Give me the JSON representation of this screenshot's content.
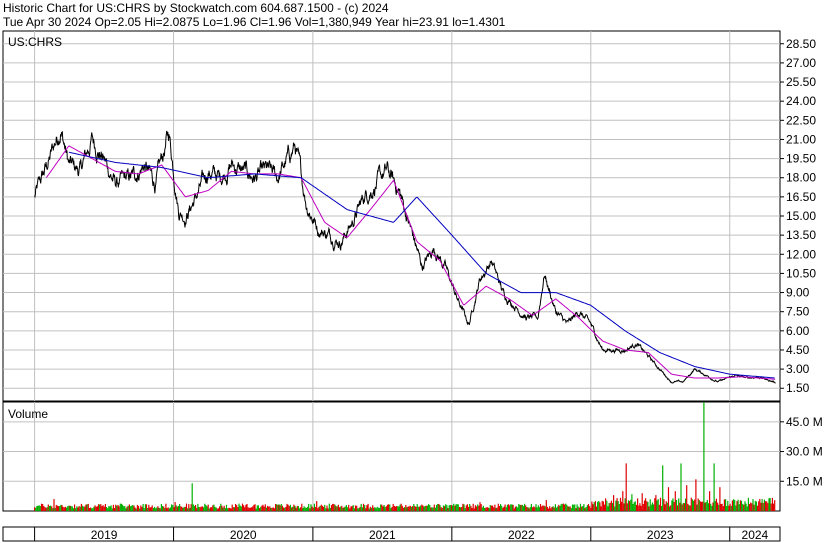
{
  "header": {
    "line1": "Historic Chart for US:CHRS by Stockwatch.com 604.687.1500 - (c) 2024",
    "line2": "Tue Apr 30 2024   Op=2.05  Hi=2.0875   Lo=1.96   Cl=1.96   Vol=1,380,949   Year hi=23.91   lo=1.4301"
  },
  "colors": {
    "price": "#000000",
    "ma_short": "#c000c0",
    "ma_long": "#0000c0",
    "volume_up": "#00b000",
    "volume_down": "#e00000",
    "grid": "#c0c0c0"
  },
  "chart_data": [
    {
      "type": "line",
      "label": "US:CHRS",
      "x_years": [
        "2019",
        "2020",
        "2021",
        "2022",
        "2023",
        "2024"
      ],
      "y_ticks": [
        "28.50",
        "27.00",
        "25.50",
        "24.00",
        "22.50",
        "21.00",
        "19.50",
        "18.00",
        "16.50",
        "15.00",
        "13.50",
        "12.00",
        "10.50",
        "9.00",
        "7.50",
        "6.00",
        "4.50",
        "3.00",
        "1.50"
      ],
      "ylim": [
        0.5,
        29.5
      ],
      "price_keypoints": [
        [
          "2019-01-01",
          16.5
        ],
        [
          "2019-02-10",
          19.5
        ],
        [
          "2019-03-10",
          22.0
        ],
        [
          "2019-04-01",
          19.0
        ],
        [
          "2019-05-01",
          18.5
        ],
        [
          "2019-06-01",
          21.0
        ],
        [
          "2019-07-01",
          19.5
        ],
        [
          "2019-08-01",
          17.5
        ],
        [
          "2019-09-15",
          18.0
        ],
        [
          "2019-10-15",
          19.0
        ],
        [
          "2019-11-15",
          17.5
        ],
        [
          "2019-12-20",
          21.5
        ],
        [
          "2020-01-15",
          15.5
        ],
        [
          "2020-02-01",
          15.0
        ],
        [
          "2020-03-01",
          16.5
        ],
        [
          "2020-04-01",
          18.5
        ],
        [
          "2020-05-01",
          18.0
        ],
        [
          "2020-06-01",
          19.0
        ],
        [
          "2020-07-01",
          18.5
        ],
        [
          "2020-08-01",
          18.0
        ],
        [
          "2020-09-01",
          18.5
        ],
        [
          "2020-10-01",
          18.0
        ],
        [
          "2020-11-15",
          20.5
        ],
        [
          "2020-12-15",
          16.0
        ],
        [
          "2021-01-15",
          14.0
        ],
        [
          "2021-02-15",
          13.5
        ],
        [
          "2021-03-15",
          13.0
        ],
        [
          "2021-04-15",
          14.5
        ],
        [
          "2021-05-15",
          16.5
        ],
        [
          "2021-06-15",
          17.5
        ],
        [
          "2021-07-15",
          18.5
        ],
        [
          "2021-08-15",
          17.0
        ],
        [
          "2021-09-15",
          14.0
        ],
        [
          "2021-10-15",
          11.0
        ],
        [
          "2021-11-15",
          12.5
        ],
        [
          "2021-12-15",
          11.0
        ],
        [
          "2022-01-15",
          8.5
        ],
        [
          "2022-02-15",
          6.5
        ],
        [
          "2022-03-15",
          10.0
        ],
        [
          "2022-04-15",
          11.5
        ],
        [
          "2022-05-15",
          9.0
        ],
        [
          "2022-06-15",
          8.0
        ],
        [
          "2022-07-15",
          7.0
        ],
        [
          "2022-08-15",
          7.0
        ],
        [
          "2022-09-01",
          10.5
        ],
        [
          "2022-10-01",
          7.5
        ],
        [
          "2022-11-01",
          6.5
        ],
        [
          "2022-12-01",
          7.5
        ],
        [
          "2023-01-01",
          6.5
        ],
        [
          "2023-02-01",
          4.5
        ],
        [
          "2023-03-01",
          4.5
        ],
        [
          "2023-04-01",
          4.5
        ],
        [
          "2023-05-01",
          5.0
        ],
        [
          "2023-06-01",
          4.0
        ],
        [
          "2023-07-01",
          3.0
        ],
        [
          "2023-08-01",
          2.0
        ],
        [
          "2023-09-01",
          2.0
        ],
        [
          "2023-10-01",
          3.0
        ],
        [
          "2023-11-01",
          2.5
        ],
        [
          "2023-12-01",
          2.0
        ],
        [
          "2024-01-15",
          2.5
        ],
        [
          "2024-02-15",
          2.3
        ],
        [
          "2024-03-15",
          2.4
        ],
        [
          "2024-04-30",
          1.96
        ]
      ],
      "ma_short_keypoints": [
        [
          "2019-02-01",
          18.0
        ],
        [
          "2019-04-01",
          20.5
        ],
        [
          "2019-06-01",
          19.5
        ],
        [
          "2019-08-01",
          18.5
        ],
        [
          "2019-10-01",
          18.3
        ],
        [
          "2019-12-01",
          19.0
        ],
        [
          "2020-02-01",
          16.5
        ],
        [
          "2020-04-01",
          17.0
        ],
        [
          "2020-06-01",
          18.5
        ],
        [
          "2020-08-01",
          18.3
        ],
        [
          "2020-10-01",
          18.3
        ],
        [
          "2020-12-01",
          18.0
        ],
        [
          "2021-02-01",
          14.5
        ],
        [
          "2021-04-01",
          13.3
        ],
        [
          "2021-06-01",
          15.5
        ],
        [
          "2021-08-01",
          17.8
        ],
        [
          "2021-10-01",
          13.0
        ],
        [
          "2021-12-01",
          11.5
        ],
        [
          "2022-02-01",
          8.0
        ],
        [
          "2022-04-01",
          9.5
        ],
        [
          "2022-06-01",
          8.5
        ],
        [
          "2022-08-01",
          7.2
        ],
        [
          "2022-10-01",
          8.5
        ],
        [
          "2022-12-01",
          7.0
        ],
        [
          "2023-02-01",
          5.2
        ],
        [
          "2023-04-01",
          4.5
        ],
        [
          "2023-06-01",
          4.3
        ],
        [
          "2023-08-01",
          2.6
        ],
        [
          "2023-10-01",
          2.3
        ],
        [
          "2023-12-01",
          2.3
        ],
        [
          "2024-02-01",
          2.4
        ],
        [
          "2024-04-30",
          2.2
        ]
      ],
      "ma_long_keypoints": [
        [
          "2019-04-01",
          20.0
        ],
        [
          "2019-08-01",
          19.2
        ],
        [
          "2019-12-01",
          18.8
        ],
        [
          "2020-04-01",
          18.0
        ],
        [
          "2020-08-01",
          18.3
        ],
        [
          "2020-12-01",
          18.0
        ],
        [
          "2021-04-01",
          15.5
        ],
        [
          "2021-08-01",
          14.5
        ],
        [
          "2021-10-01",
          16.5
        ],
        [
          "2022-01-01",
          13.5
        ],
        [
          "2022-04-01",
          10.5
        ],
        [
          "2022-07-01",
          9.0
        ],
        [
          "2022-10-01",
          9.0
        ],
        [
          "2023-01-01",
          8.0
        ],
        [
          "2023-04-01",
          6.0
        ],
        [
          "2023-07-01",
          4.3
        ],
        [
          "2023-10-01",
          3.2
        ],
        [
          "2024-01-01",
          2.6
        ],
        [
          "2024-04-30",
          2.3
        ]
      ]
    },
    {
      "type": "bar",
      "label": "Volume",
      "y_ticks": [
        "45.0 M",
        "30.0 M",
        "15.0 M"
      ],
      "ylim": [
        0,
        55
      ],
      "baseline_millions": 2.5,
      "spikes_millions": [
        [
          "2019-02-20",
          6.0,
          "red"
        ],
        [
          "2020-01-05",
          4.5,
          "red"
        ],
        [
          "2020-02-20",
          14.0,
          "green"
        ],
        [
          "2021-01-10",
          5.0,
          "red"
        ],
        [
          "2022-03-15",
          4.5,
          "red"
        ],
        [
          "2022-09-05",
          5.5,
          "red"
        ],
        [
          "2023-03-01",
          8.0,
          "red"
        ],
        [
          "2023-03-10",
          6.5,
          "red"
        ],
        [
          "2023-03-25",
          10.0,
          "red"
        ],
        [
          "2023-04-03",
          24.0,
          "red"
        ],
        [
          "2023-04-20",
          8.5,
          "green"
        ],
        [
          "2023-05-15",
          9.0,
          "red"
        ],
        [
          "2023-06-20",
          8.0,
          "red"
        ],
        [
          "2023-07-10",
          23.0,
          "green"
        ],
        [
          "2023-07-25",
          12.0,
          "red"
        ],
        [
          "2023-08-10",
          10.0,
          "red"
        ],
        [
          "2023-08-25",
          24.0,
          "green"
        ],
        [
          "2023-09-10",
          13.0,
          "red"
        ],
        [
          "2023-10-05",
          16.0,
          "red"
        ],
        [
          "2023-10-25",
          55.0,
          "green"
        ],
        [
          "2023-11-10",
          10.0,
          "red"
        ],
        [
          "2023-11-20",
          24.0,
          "green"
        ],
        [
          "2023-12-05",
          12.0,
          "red"
        ],
        [
          "2023-12-20",
          6.0,
          "green"
        ],
        [
          "2024-01-20",
          5.0,
          "red"
        ],
        [
          "2024-03-01",
          6.0,
          "green"
        ],
        [
          "2024-04-10",
          4.0,
          "red"
        ]
      ]
    }
  ]
}
